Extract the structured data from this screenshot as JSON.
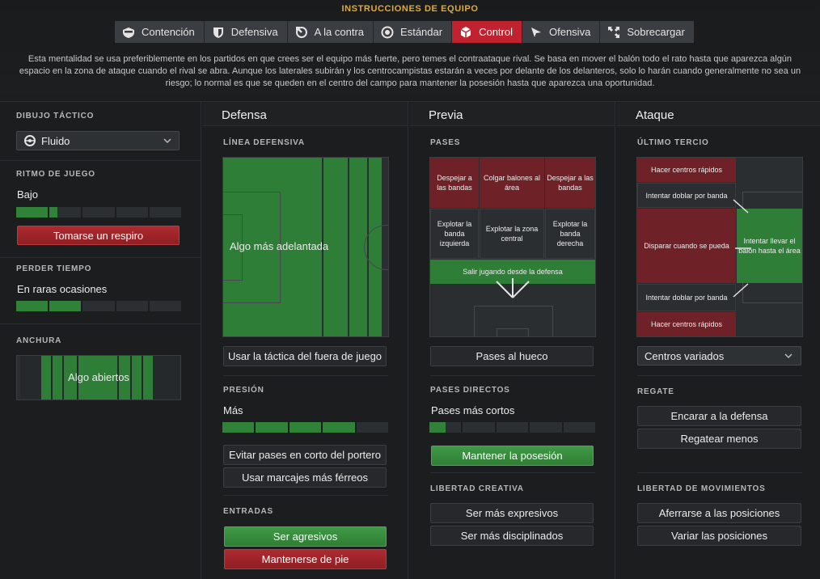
{
  "header": {
    "title": "INSTRUCCIONES DE EQUIPO",
    "tabs": [
      {
        "label": "Contención",
        "icon": "shield-icon"
      },
      {
        "label": "Defensiva",
        "icon": "shield-icon"
      },
      {
        "label": "A la contra",
        "icon": "counter-icon"
      },
      {
        "label": "Estándar",
        "icon": "target-icon"
      },
      {
        "label": "Control",
        "icon": "cube-icon",
        "active": true
      },
      {
        "label": "Ofensiva",
        "icon": "attack-arrow-icon"
      },
      {
        "label": "Sobrecargar",
        "icon": "arrows-out-icon"
      }
    ],
    "description": "Esta mentalidad se usa preferiblemente en los partidos en que crees ser el equipo más fuerte, pero temes el contraataque rival. Se basa en mover el balón todo el rato hasta que aparezca algún espacio en la zona de ataque cuando el rival se abra. Aunque los laterales subirán y los centrocampistas estarán a veces por delante de los delanteros, solo lo harán cuando generalmente no sea un riesgo; lo normal es que se queden en el centro del campo para mantener la posesión hasta que aparezca una oportunidad."
  },
  "left": {
    "dibujo": {
      "label": "DIBUJO TÁCTICO",
      "value": "Fluido",
      "icon": "fluid-icon"
    },
    "ritmo": {
      "label": "RITMO DE JUEGO",
      "value": "Bajo",
      "level": 0.25,
      "button": "Tomarse un respiro"
    },
    "perder": {
      "label": "PERDER TIEMPO",
      "value": "En raras ocasiones",
      "level": 0.4
    },
    "anchura": {
      "label": "ANCHURA",
      "value": "Algo abiertos"
    }
  },
  "defensa": {
    "title": "Defensa",
    "linea_label": "LÍNEA DEFENSIVA",
    "linea_value": "Algo más adelantada",
    "fuera_juego": "Usar la táctica del fuera de juego",
    "presion_label": "PRESIÓN",
    "presion_value": "Más",
    "presion_level": 0.8,
    "buttons": [
      "Evitar pases en corto del portero",
      "Usar marcajes más férreos"
    ],
    "entradas_label": "ENTRADAS",
    "entradas": [
      "Ser agresivos",
      "Mantenerse de pie"
    ]
  },
  "previa": {
    "title": "Previa",
    "pases_label": "PASES",
    "zones": {
      "despejar_left": "Despejar a las bandas",
      "colgar": "Colgar balones al área",
      "despejar_right": "Despejar a las bandas",
      "explotar_izq": "Explotar la banda izquierda",
      "explotar_centro": "Explotar la zona central",
      "explotar_der": "Explotar la banda derecha",
      "salir": "Salir jugando desde la defensa"
    },
    "pases_hueco": "Pases al hueco",
    "directos_label": "PASES DIRECTOS",
    "directos_value": "Pases más cortos",
    "directos_level": 0.1,
    "posesion": "Mantener la posesión",
    "creativa_label": "LIBERTAD CREATIVA",
    "creativa": [
      "Ser más expresivos",
      "Ser más disciplinados"
    ]
  },
  "ataque": {
    "title": "Ataque",
    "tercio_label": "ÚLTIMO TERCIO",
    "zones": {
      "centros_top": "Hacer centros rápidos",
      "doblar_top": "Intentar doblar por banda",
      "disparar": "Disparar cuando se pueda",
      "llevar": "Intentar llevar el balón hasta el área",
      "doblar_bottom": "Intentar doblar por banda",
      "centros_bottom": "Hacer centros rápidos"
    },
    "centros": "Centros variados",
    "regate_label": "REGATE",
    "regate": [
      "Encarar a la defensa",
      "Regatear menos"
    ],
    "movimientos_label": "LIBERTAD DE MOVIMIENTOS",
    "movimientos": [
      "Aferrarse a las posiciones",
      "Variar las posiciones"
    ]
  },
  "colors": {
    "accent": "#e2a936",
    "active_tab": "#c0232f",
    "green": "#2f7e38",
    "red": "#6e2227"
  }
}
